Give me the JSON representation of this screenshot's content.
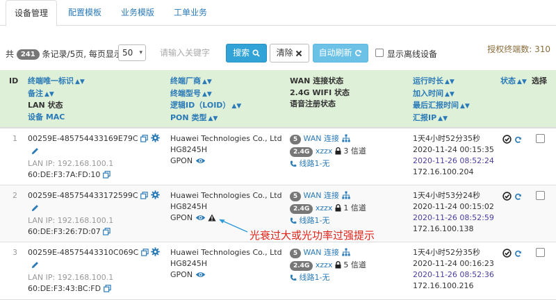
{
  "tabs": [
    "设备管理",
    "配置模板",
    "业务模版",
    "工单业务"
  ],
  "toolbar": {
    "total_prefix": "共",
    "total_count": "241",
    "total_suffix": "条记录/5页, 每页显示",
    "page_size": "50",
    "search_placeholder": "请输入关键字",
    "search_label": "搜索",
    "clear_label": "清除",
    "refresh_label": "自动刷新",
    "show_offline_label": "显示离线设备",
    "licensed_label": "授权终端数: 310"
  },
  "headers": {
    "id": "ID",
    "col2": [
      "终端唯一标识",
      "备注",
      "LAN 状态",
      "设备 MAC"
    ],
    "col3": [
      "终端厂商",
      "终端型号",
      "逻辑ID（LOID）",
      "PON 类型"
    ],
    "col4": [
      "WAN 连接状态",
      "2.4G WIFI 状态",
      "语音注册状态"
    ],
    "col5": [
      "运行时长",
      "加入时间",
      "最后汇报时间",
      "汇报IP"
    ],
    "status": "状态",
    "select": "选择"
  },
  "rows": [
    {
      "id": "1",
      "device_id": "00259E-485754433169E79C",
      "lan_ip": "LAN IP: 192.168.100.1",
      "mac": "60:DE:F3:7A:FD:10",
      "vendor": "Huawei Technologies Co., Ltd",
      "model": "HG8245H",
      "pon": "GPON",
      "wan_count": "5",
      "wan_label": "WAN 连接",
      "band": "2.4G",
      "ssid": "xzzx",
      "channel": "3 信道",
      "voice": "线路1-无",
      "uptime": "1天4小时52分35秒",
      "joined": "2020-11-24 00:15:35",
      "last_report": "2020-11-26 08:52:24",
      "report_ip": "172.16.100.204"
    },
    {
      "id": "2",
      "device_id": "00259E-485754433172599C",
      "lan_ip": "LAN IP: 192.168.100.1",
      "mac": "60:DE:F3:26:7D:07",
      "vendor": "Huawei Technologies Co., Ltd",
      "model": "HG8245H",
      "pon": "GPON",
      "wan_count": "5",
      "wan_label": "WAN 连接",
      "band": "2.4G",
      "ssid": "xzzx",
      "channel": "1 信道",
      "voice": "线路1-无",
      "uptime": "1天4小时53分24秒",
      "joined": "2020-11-24 00:15:02",
      "last_report": "2020-11-26 08:52:59",
      "report_ip": "172.16.100.138"
    },
    {
      "id": "3",
      "device_id": "00259E-48575443310C069C",
      "lan_ip": "LAN IP: 192.168.100.1",
      "mac": "60:DE:F3:43:BC:FD",
      "vendor": "Huawei Technologies Co., Ltd",
      "model": "HG8245H",
      "pon": "GPON",
      "wan_count": "5",
      "wan_label": "WAN 连接",
      "band": "2.4G",
      "ssid": "xzzx",
      "channel": "5 信道",
      "voice": "线路1-无",
      "uptime": "1天4小时52分35秒",
      "joined": "2020-11-24 00:16:23",
      "last_report": "2020-11-26 08:52:36",
      "report_ip": "172.16.100.216"
    }
  ],
  "annotation": "光衰过大或光功率过强提示",
  "colors": {
    "link": "#2a7ab8",
    "header_bg": "#dff0d8",
    "search_button": "#31a3d7",
    "refresh_button": "#6cc2e6",
    "annotation": "#e2231a",
    "report_time": "#4a3fa0"
  },
  "icons": [
    "copy-icon",
    "gear-icon",
    "pencil-icon",
    "eye-icon",
    "warning-icon",
    "network-icon",
    "lock-icon",
    "phone-icon",
    "check-circle-icon",
    "refresh-icon",
    "search-icon",
    "close-icon",
    "sort-icon"
  ]
}
